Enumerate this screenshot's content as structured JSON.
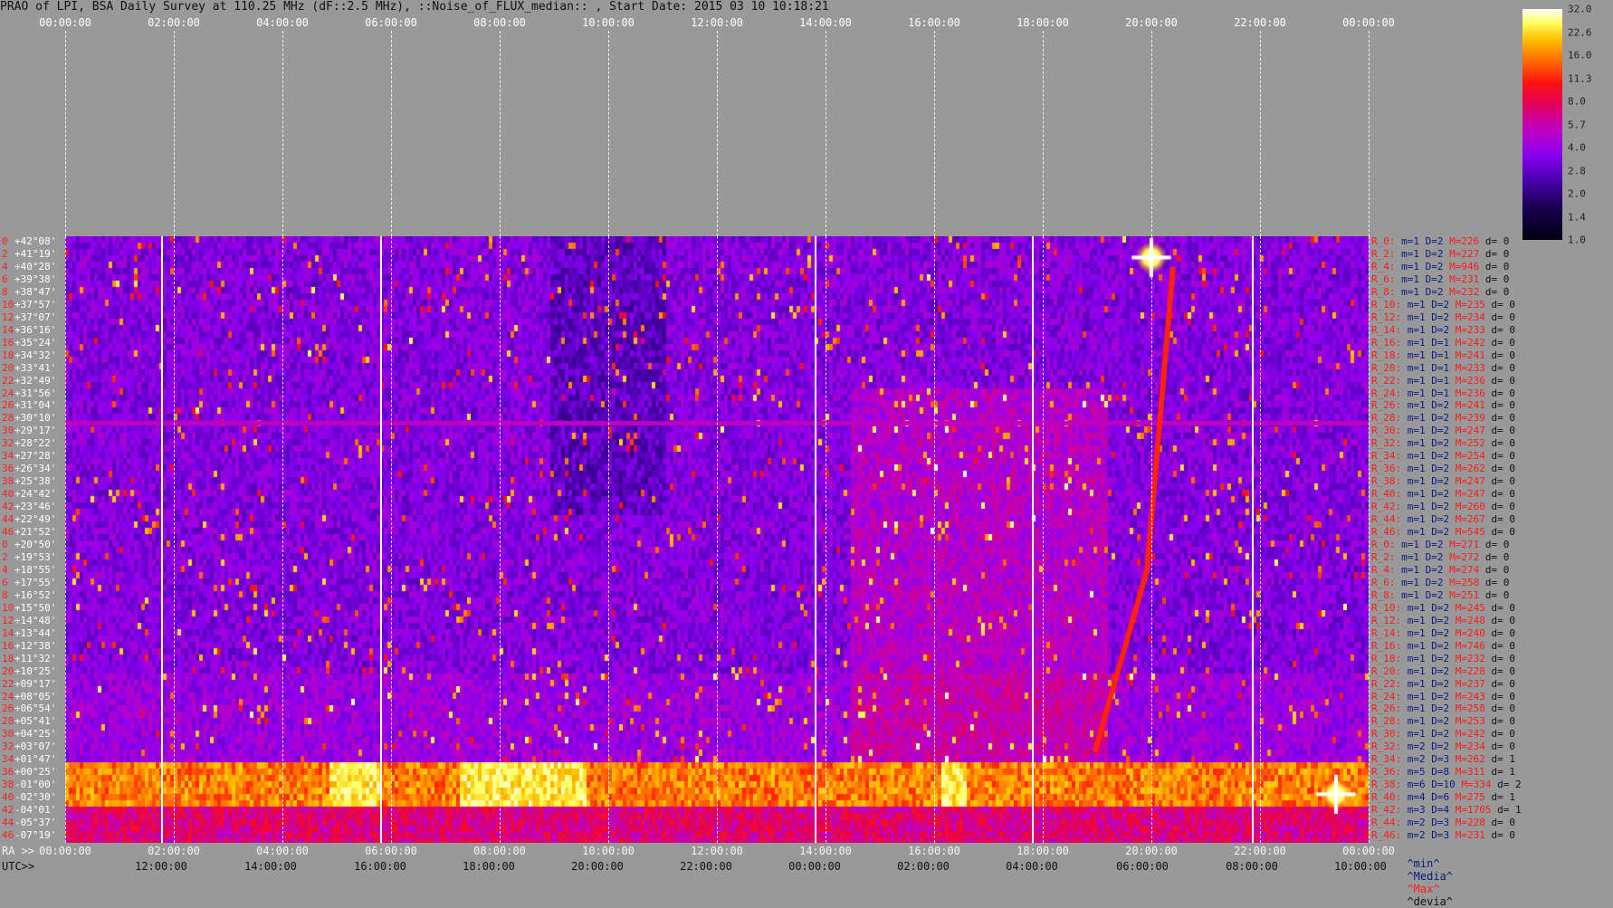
{
  "title": "PRAO of LPI, BSA Daily Survey at 110.25 MHz (dF::2.5 MHz), ::Noise_of_FLUX_median:: , Start Date: 2015 03 10 10:18:21",
  "top_axis_ticks": [
    "00:00:00",
    "02:00:00",
    "04:00:00",
    "06:00:00",
    "08:00:00",
    "10:00:00",
    "12:00:00",
    "14:00:00",
    "16:00:00",
    "18:00:00",
    "20:00:00",
    "22:00:00",
    "00:00:00"
  ],
  "ra_axis": {
    "label": "RA >>",
    "ticks": [
      "00:00:00",
      "02:00:00",
      "04:00:00",
      "06:00:00",
      "08:00:00",
      "10:00:00",
      "12:00:00",
      "14:00:00",
      "16:00:00",
      "18:00:00",
      "20:00:00",
      "22:00:00",
      "00:00:00"
    ]
  },
  "utc_axis": {
    "label": "UTC>>",
    "ticks": [
      "12:00:00",
      "14:00:00",
      "16:00:00",
      "18:00:00",
      "20:00:00",
      "22:00:00",
      "00:00:00",
      "02:00:00",
      "04:00:00",
      "06:00:00",
      "08:00:00",
      "10:00:00"
    ]
  },
  "colorbar": {
    "ticks": [
      "32.0",
      "22.6",
      "16.0",
      "11.3",
      "8.0",
      "5.7",
      "4.0",
      "2.8",
      "2.0",
      "1.4",
      "1.0"
    ]
  },
  "legend": {
    "min": "^min^",
    "media": "^Media^",
    "max": "^Max^",
    "devia": "^devia^"
  },
  "declinations": [
    {
      "i": "0",
      "d": "+42°08'"
    },
    {
      "i": "2",
      "d": "+41°19'"
    },
    {
      "i": "4",
      "d": "+40°28'"
    },
    {
      "i": "6",
      "d": "+39°38'"
    },
    {
      "i": "8",
      "d": "+38°47'"
    },
    {
      "i": "10",
      "d": "+37°57'"
    },
    {
      "i": "12",
      "d": "+37°07'"
    },
    {
      "i": "14",
      "d": "+36°16'"
    },
    {
      "i": "16",
      "d": "+35°24'"
    },
    {
      "i": "18",
      "d": "+34°32'"
    },
    {
      "i": "20",
      "d": "+33°41'"
    },
    {
      "i": "22",
      "d": "+32°49'"
    },
    {
      "i": "24",
      "d": "+31°56'"
    },
    {
      "i": "26",
      "d": "+31°04'"
    },
    {
      "i": "28",
      "d": "+30°10'"
    },
    {
      "i": "30",
      "d": "+29°17'"
    },
    {
      "i": "32",
      "d": "+28°22'"
    },
    {
      "i": "34",
      "d": "+27°28'"
    },
    {
      "i": "36",
      "d": "+26°34'"
    },
    {
      "i": "38",
      "d": "+25°38'"
    },
    {
      "i": "40",
      "d": "+24°42'"
    },
    {
      "i": "42",
      "d": "+23°46'"
    },
    {
      "i": "44",
      "d": "+22°49'"
    },
    {
      "i": "46",
      "d": "+21°52'"
    },
    {
      "i": "0",
      "d": "+20°50'"
    },
    {
      "i": "2",
      "d": "+19°53'"
    },
    {
      "i": "4",
      "d": "+18°55'"
    },
    {
      "i": "6",
      "d": "+17°55'"
    },
    {
      "i": "8",
      "d": "+16°52'"
    },
    {
      "i": "10",
      "d": "+15°50'"
    },
    {
      "i": "12",
      "d": "+14°48'"
    },
    {
      "i": "14",
      "d": "+13°44'"
    },
    {
      "i": "16",
      "d": "+12°38'"
    },
    {
      "i": "18",
      "d": "+11°32'"
    },
    {
      "i": "20",
      "d": "+10°25'"
    },
    {
      "i": "22",
      "d": "+09°17'"
    },
    {
      "i": "24",
      "d": "+08°05'"
    },
    {
      "i": "26",
      "d": "+06°54'"
    },
    {
      "i": "28",
      "d": "+05°41'"
    },
    {
      "i": "30",
      "d": "+04°25'"
    },
    {
      "i": "32",
      "d": "+03°07'"
    },
    {
      "i": "34",
      "d": "+01°47'"
    },
    {
      "i": "36",
      "d": "+00°25'"
    },
    {
      "i": "38",
      "d": "-01°00'"
    },
    {
      "i": "40",
      "d": "-02°30'"
    },
    {
      "i": "42",
      "d": "-04°01'"
    },
    {
      "i": "44",
      "d": "-05°37'"
    },
    {
      "i": "46",
      "d": "-07°19'"
    }
  ],
  "row_stats": [
    {
      "r": "R_0:",
      "m": "m=1",
      "d": "D=2",
      "x": "M=226",
      "v": "d= 0"
    },
    {
      "r": "R_2:",
      "m": "m=1",
      "d": "D=2",
      "x": "M=227",
      "v": "d= 0"
    },
    {
      "r": "R_4:",
      "m": "m=1",
      "d": "D=2",
      "x": "M=946",
      "v": "d= 0"
    },
    {
      "r": "R_6:",
      "m": "m=1",
      "d": "D=2",
      "x": "M=231",
      "v": "d= 0"
    },
    {
      "r": "R_8:",
      "m": "m=1",
      "d": "D=2",
      "x": "M=232",
      "v": "d= 0"
    },
    {
      "r": "R_10:",
      "m": "m=1",
      "d": "D=2",
      "x": "M=235",
      "v": "d= 0"
    },
    {
      "r": "R_12:",
      "m": "m=1",
      "d": "D=2",
      "x": "M=234",
      "v": "d= 0"
    },
    {
      "r": "R_14:",
      "m": "m=1",
      "d": "D=2",
      "x": "M=233",
      "v": "d= 0"
    },
    {
      "r": "R_16:",
      "m": "m=1",
      "d": "D=1",
      "x": "M=242",
      "v": "d= 0"
    },
    {
      "r": "R_18:",
      "m": "m=1",
      "d": "D=1",
      "x": "M=241",
      "v": "d= 0"
    },
    {
      "r": "R_20:",
      "m": "m=1",
      "d": "D=1",
      "x": "M=233",
      "v": "d= 0"
    },
    {
      "r": "R_22:",
      "m": "m=1",
      "d": "D=1",
      "x": "M=236",
      "v": "d= 0"
    },
    {
      "r": "R_24:",
      "m": "m=1",
      "d": "D=1",
      "x": "M=236",
      "v": "d= 0"
    },
    {
      "r": "R_26:",
      "m": "m=1",
      "d": "D=2",
      "x": "M=241",
      "v": "d= 0"
    },
    {
      "r": "R_28:",
      "m": "m=1",
      "d": "D=2",
      "x": "M=239",
      "v": "d= 0"
    },
    {
      "r": "R_30:",
      "m": "m=1",
      "d": "D=2",
      "x": "M=247",
      "v": "d= 0"
    },
    {
      "r": "R_32:",
      "m": "m=1",
      "d": "D=2",
      "x": "M=252",
      "v": "d= 0"
    },
    {
      "r": "R_34:",
      "m": "m=1",
      "d": "D=2",
      "x": "M=254",
      "v": "d= 0"
    },
    {
      "r": "R_36:",
      "m": "m=1",
      "d": "D=2",
      "x": "M=262",
      "v": "d= 0"
    },
    {
      "r": "R_38:",
      "m": "m=1",
      "d": "D=2",
      "x": "M=247",
      "v": "d= 0"
    },
    {
      "r": "R_40:",
      "m": "m=1",
      "d": "D=2",
      "x": "M=247",
      "v": "d= 0"
    },
    {
      "r": "R_42:",
      "m": "m=1",
      "d": "D=2",
      "x": "M=260",
      "v": "d= 0"
    },
    {
      "r": "R_44:",
      "m": "m=1",
      "d": "D=2",
      "x": "M=267",
      "v": "d= 0"
    },
    {
      "r": "R_46:",
      "m": "m=1",
      "d": "D=2",
      "x": "M=545",
      "v": "d= 0"
    },
    {
      "r": "R_0:",
      "m": "m=1",
      "d": "D=2",
      "x": "M=271",
      "v": "d= 0"
    },
    {
      "r": "R_2:",
      "m": "m=1",
      "d": "D=2",
      "x": "M=272",
      "v": "d= 0"
    },
    {
      "r": "R_4:",
      "m": "m=1",
      "d": "D=2",
      "x": "M=274",
      "v": "d= 0"
    },
    {
      "r": "R_6:",
      "m": "m=1",
      "d": "D=2",
      "x": "M=258",
      "v": "d= 0"
    },
    {
      "r": "R_8:",
      "m": "m=1",
      "d": "D=2",
      "x": "M=251",
      "v": "d= 0"
    },
    {
      "r": "R_10:",
      "m": "m=1",
      "d": "D=2",
      "x": "M=245",
      "v": "d= 0"
    },
    {
      "r": "R_12:",
      "m": "m=1",
      "d": "D=2",
      "x": "M=248",
      "v": "d= 0"
    },
    {
      "r": "R_14:",
      "m": "m=1",
      "d": "D=2",
      "x": "M=240",
      "v": "d= 0"
    },
    {
      "r": "R_16:",
      "m": "m=1",
      "d": "D=2",
      "x": "M=746",
      "v": "d= 0"
    },
    {
      "r": "R_18:",
      "m": "m=1",
      "d": "D=2",
      "x": "M=232",
      "v": "d= 0"
    },
    {
      "r": "R_20:",
      "m": "m=1",
      "d": "D=2",
      "x": "M=228",
      "v": "d= 0"
    },
    {
      "r": "R_22:",
      "m": "m=1",
      "d": "D=2",
      "x": "M=237",
      "v": "d= 0"
    },
    {
      "r": "R_24:",
      "m": "m=1",
      "d": "D=2",
      "x": "M=243",
      "v": "d= 0"
    },
    {
      "r": "R_26:",
      "m": "m=1",
      "d": "D=2",
      "x": "M=258",
      "v": "d= 0"
    },
    {
      "r": "R_28:",
      "m": "m=1",
      "d": "D=2",
      "x": "M=253",
      "v": "d= 0"
    },
    {
      "r": "R_30:",
      "m": "m=1",
      "d": "D=2",
      "x": "M=242",
      "v": "d= 0"
    },
    {
      "r": "R_32:",
      "m": "m=2",
      "d": "D=2",
      "x": "M=234",
      "v": "d= 0"
    },
    {
      "r": "R_34:",
      "m": "m=2",
      "d": "D=3",
      "x": "M=262",
      "v": "d= 1"
    },
    {
      "r": "R_36:",
      "m": "m=5",
      "d": "D=8",
      "x": "M=311",
      "v": "d= 1"
    },
    {
      "r": "R_38:",
      "m": "m=6",
      "d": "D=10",
      "x": "M=334",
      "v": "d= 2"
    },
    {
      "r": "R_40:",
      "m": "m=4",
      "d": "D=6",
      "x": "M=275",
      "v": "d= 1"
    },
    {
      "r": "R_42:",
      "m": "m=3",
      "d": "D=4",
      "x": "M=1705",
      "v": "d= 1"
    },
    {
      "r": "R_44:",
      "m": "m=2",
      "d": "D=3",
      "x": "M=228",
      "v": "d= 0"
    },
    {
      "r": "R_46:",
      "m": "m=2",
      "d": "D=3",
      "x": "M=231",
      "v": "d= 0"
    }
  ],
  "chart_data": {
    "type": "heatmap",
    "title": "PRAO of LPI, BSA Daily Survey at 110.25 MHz (dF::2.5 MHz), ::Noise_of_FLUX_median:: , Start Date: 2015 03 10 10:18:21",
    "x_axis": {
      "label": "RA",
      "range": [
        "00:00:00",
        "24:00:00"
      ]
    },
    "y_axis": {
      "label": "",
      "range": [
        "+42°08'",
        "-07°19'"
      ]
    },
    "color_scale": {
      "type": "log",
      "range": [
        1.0,
        32.0
      ],
      "colors": [
        "#000010",
        "#1a0050",
        "#4c00b0",
        "#8a00f0",
        "#c000c0",
        "#e00060",
        "#ff1010",
        "#ff7000",
        "#ffc000",
        "#ffff60",
        "#ffffff"
      ]
    },
    "features": {
      "bright_band_rows_dec": [
        "+01°47'",
        "-02°30'"
      ],
      "bright_source_1": {
        "ra_hours": 20.0,
        "dec": "+40°28'"
      },
      "bright_source_2": {
        "ra_hours": 23.4,
        "dec": "-04°01'"
      },
      "drift_track_ra_hours": [
        18.9,
        19.7
      ]
    }
  }
}
